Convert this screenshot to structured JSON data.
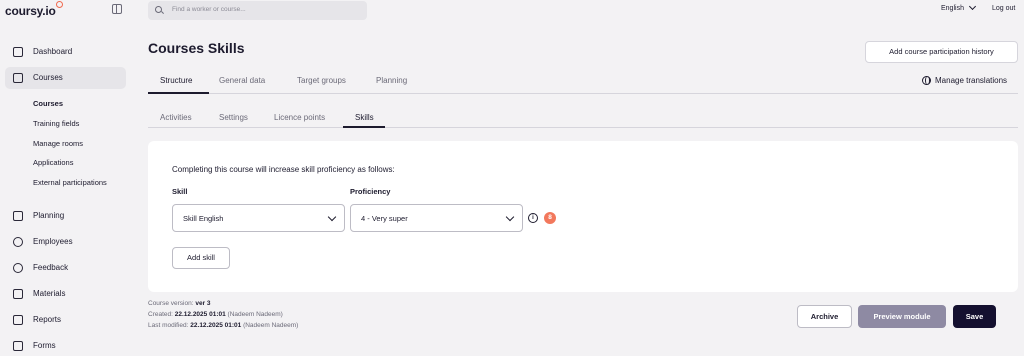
{
  "app": {
    "logo": "coursy.io"
  },
  "search": {
    "placeholder": "Find a worker or course..."
  },
  "topbar": {
    "language": "English",
    "logout": "Log out"
  },
  "sidebar": {
    "items": [
      {
        "label": "Dashboard",
        "icon": "dashboard-icon"
      },
      {
        "label": "Courses",
        "icon": "courses-icon"
      },
      {
        "label": "Planning",
        "icon": "calendar-icon"
      },
      {
        "label": "Employees",
        "icon": "employees-icon"
      },
      {
        "label": "Feedback",
        "icon": "feedback-icon"
      },
      {
        "label": "Materials",
        "icon": "materials-icon"
      },
      {
        "label": "Reports",
        "icon": "reports-icon"
      },
      {
        "label": "Forms",
        "icon": "forms-icon"
      }
    ],
    "sub_items": [
      "Courses",
      "Training fields",
      "Manage rooms",
      "Applications",
      "External participations"
    ]
  },
  "header": {
    "title": "Courses Skills",
    "add_history_button": "Add course participation history",
    "manage_translations": "Manage translations"
  },
  "tabs": [
    "Structure",
    "General data",
    "Target groups",
    "Planning"
  ],
  "subtabs": [
    "Activities",
    "Settings",
    "Licence points",
    "Skills"
  ],
  "skills": {
    "intro": "Completing this course will increase skill proficiency as follows:",
    "skill_label": "Skill",
    "proficiency_label": "Proficiency",
    "skill_value": "Skill English",
    "proficiency_value": "4 - Very super",
    "info_glyph": "i",
    "badge_count": "8",
    "add_skill_button": "Add skill"
  },
  "footer": {
    "version_label": "Course version:",
    "version_value": "ver 3",
    "created_label": "Created:",
    "created_date": "22.12.2025 01:01",
    "created_by": "(Nadeem Nadeem)",
    "modified_label": "Last modified:",
    "modified_date": "22.12.2025 01:01",
    "modified_by": "(Nadeem Nadeem)",
    "archive_button": "Archive",
    "preview_button": "Preview module",
    "save_button": "Save"
  },
  "colors": {
    "accent": "#f06a4f",
    "primary": "#14102f",
    "preview": "#8e8aa3"
  }
}
